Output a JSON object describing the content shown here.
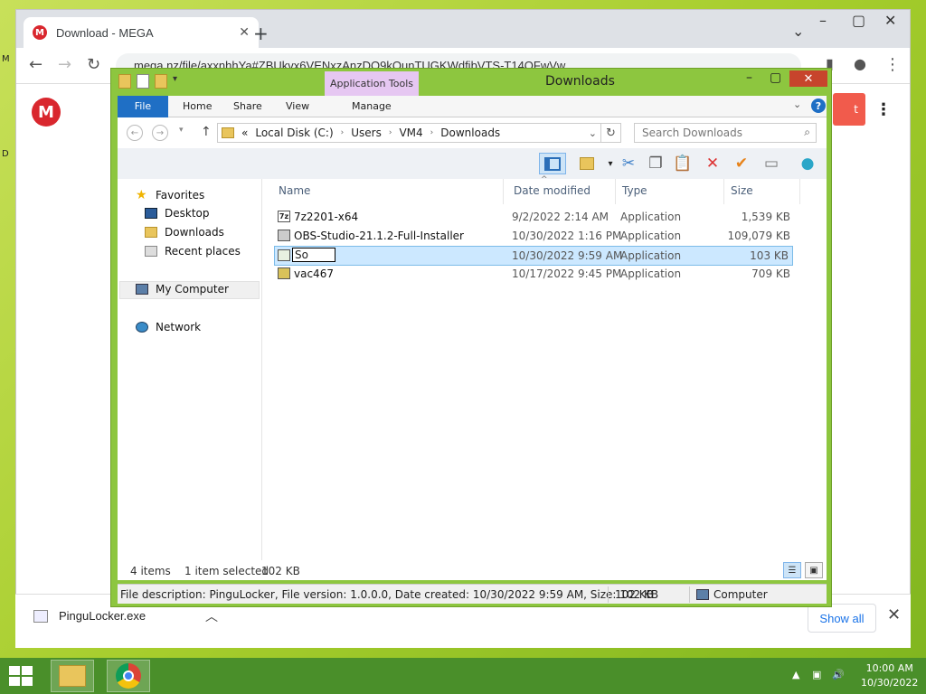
{
  "browser": {
    "tab_title": "Download - MEGA",
    "url": "mega.nz/file/axxnhhYa#ZBUkvx6VENxzAnzDQ9kOunTUGKWdfibVTS-T14OFwVw",
    "page_button_label": "t"
  },
  "download_shelf": {
    "filename": "PinguLocker.exe",
    "show_all": "Show all"
  },
  "explorer": {
    "title": "Downloads",
    "context_tab": "Application Tools",
    "ribbon_tabs": [
      "File",
      "Home",
      "Share",
      "View",
      "Manage"
    ],
    "path": [
      "Local Disk (C:)",
      "Users",
      "VM4",
      "Downloads"
    ],
    "path_prefix": "«",
    "search_placeholder": "Search Downloads",
    "nav": {
      "favorites": "Favorites",
      "desktop": "Desktop",
      "downloads": "Downloads",
      "recent": "Recent places",
      "my_computer": "My Computer",
      "network": "Network"
    },
    "columns": {
      "name": "Name",
      "date": "Date modified",
      "type": "Type",
      "size": "Size"
    },
    "files": [
      {
        "name": "7z2201-x64",
        "date": "9/2/2022 2:14 AM",
        "type": "Application",
        "size": "1,539 KB",
        "icon": "7z-icon"
      },
      {
        "name": "OBS-Studio-21.1.2-Full-Installer",
        "date": "10/30/2022 1:16 PM",
        "type": "Application",
        "size": "109,079 KB",
        "icon": "obs-icon"
      },
      {
        "name": "So",
        "date": "10/30/2022 9:59 AM",
        "type": "Application",
        "size": "103 KB",
        "icon": "app-icon",
        "renaming": true
      },
      {
        "name": "vac467",
        "date": "10/17/2022 9:45 PM",
        "type": "Application",
        "size": "709 KB",
        "icon": "installer-icon"
      }
    ],
    "status": {
      "count": "4 items",
      "selected": "1 item selected",
      "selected_size": "102 KB"
    },
    "infobar": {
      "description": "File description: PinguLocker, File version: 1.0.0.0, Date created: 10/30/2022 9:59 AM, Size: 102 KB",
      "size": "102 KB",
      "location": "Computer"
    }
  },
  "taskbar": {
    "time": "10:00 AM",
    "date": "10/30/2022"
  },
  "desktop_edge": {
    "m": "M",
    "d": "D"
  }
}
